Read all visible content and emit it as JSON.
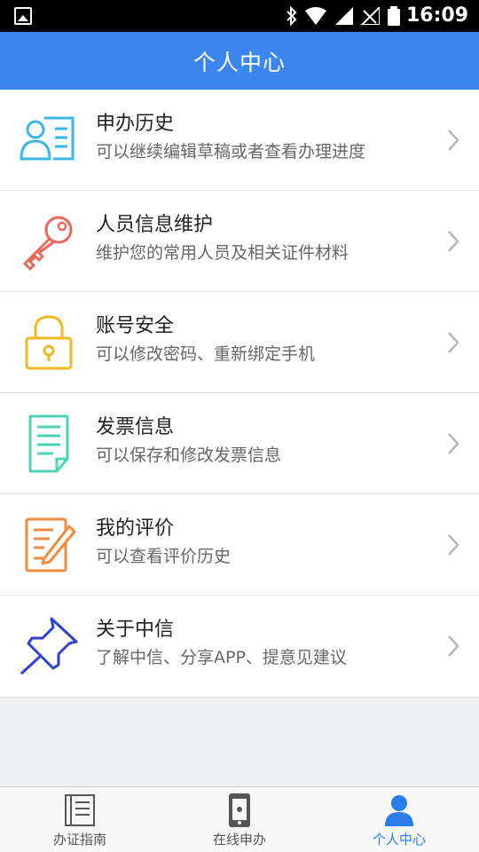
{
  "status_bar": {
    "time": "16:09"
  },
  "header": {
    "title": "个人中心"
  },
  "menu": [
    {
      "title": "申办历史",
      "subtitle": "可以继续编辑草稿或者查看办理进度",
      "icon": "user-card-icon"
    },
    {
      "title": "人员信息维护",
      "subtitle": "维护您的常用人员及相关证件材料",
      "icon": "key-icon"
    },
    {
      "title": "账号安全",
      "subtitle": "可以修改密码、重新绑定手机",
      "icon": "lock-icon"
    },
    {
      "title": "发票信息",
      "subtitle": "可以保存和修改发票信息",
      "icon": "document-icon"
    },
    {
      "title": "我的评价",
      "subtitle": "可以查看评价历史",
      "icon": "edit-note-icon"
    },
    {
      "title": "关于中信",
      "subtitle": "了解中信、分享APP、提意见建议",
      "icon": "pushpin-icon"
    }
  ],
  "tabs": [
    {
      "label": "办证指南",
      "icon": "guide-book-icon",
      "active": false
    },
    {
      "label": "在线申办",
      "icon": "phone-icon",
      "active": false
    },
    {
      "label": "个人中心",
      "icon": "person-icon",
      "active": true
    }
  ],
  "colors": {
    "header": "#3b85ee",
    "active_tab": "#2b7de9",
    "icon_blue": "#3ab6e8",
    "icon_red": "#e8685a",
    "icon_yellow": "#f2b822",
    "icon_green": "#4fd3b5",
    "icon_orange": "#f08a3c",
    "icon_navy": "#2f3fd0"
  }
}
